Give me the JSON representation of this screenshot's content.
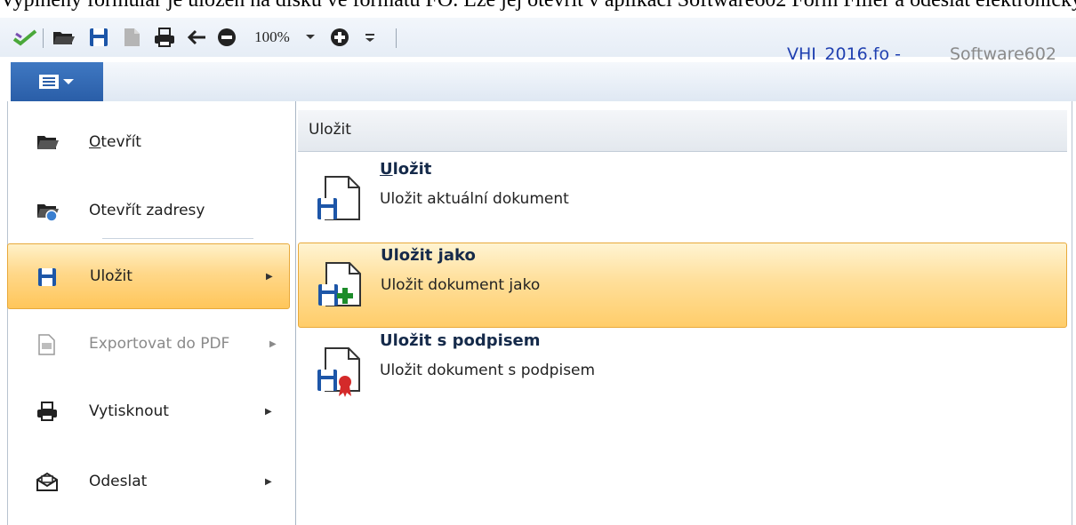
{
  "document_text": "Vyplněný formulář je uložen na disku ve formátu FO. Lze jej otevřít v aplikaci Software602 Form Filler a odeslat elektronicky.",
  "quick_access": {
    "zoom": "100%"
  },
  "window": {
    "file_name": "VHI_2016.fo -",
    "app_name": "Software602"
  },
  "colors": {
    "accent": "#2a5ea8",
    "highlight": "#ffd88a",
    "title_blue": "#1f3fb0"
  },
  "menu": {
    "items": [
      {
        "accel": "O",
        "rest": "tevřít",
        "label": "Otevřít",
        "icon": "folder-open-icon"
      },
      {
        "accel": "",
        "rest": "Otevřít zadresy",
        "label": "Otevřít zadresy",
        "icon": "folder-web-icon"
      },
      {
        "accel": "",
        "rest": "Uložit",
        "label": "Uložit",
        "icon": "floppy-icon",
        "arrow": "▶"
      },
      {
        "accel": "",
        "rest": "Exportovat do PDF",
        "label": "Exportovat do PDF",
        "icon": "pdf-export-icon",
        "arrow": "▶"
      },
      {
        "accel": "",
        "rest": "Vytisknout",
        "label": "Vytisknout",
        "icon": "printer-icon",
        "arrow": "▶"
      },
      {
        "accel": "",
        "rest": "Odeslat",
        "label": "Odeslat",
        "icon": "envelope-icon",
        "arrow": "▶"
      }
    ]
  },
  "submenu": {
    "header": "Uložit",
    "items": [
      {
        "title_accel": "U",
        "title_rest": "ložit",
        "desc": "Uložit aktuální dokument",
        "icon": "save-document-icon"
      },
      {
        "title_pre": "Uložit ",
        "title_accel": "j",
        "title_rest": "ako",
        "desc": "Uložit dokument jako",
        "icon": "save-as-icon"
      },
      {
        "title": "Uložit s podpisem",
        "desc": "Uložit dokument s podpisem",
        "icon": "save-signed-icon"
      }
    ]
  }
}
